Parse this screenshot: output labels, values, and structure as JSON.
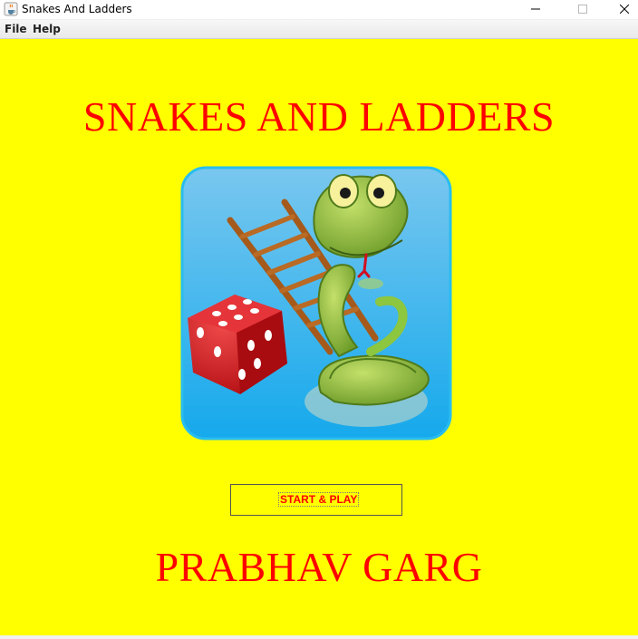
{
  "window": {
    "title": "Snakes And Ladders",
    "icon": "java-coffee-icon",
    "controls": [
      "minimize-icon",
      "maximize-icon",
      "close-icon"
    ]
  },
  "menubar": {
    "items": [
      {
        "label": "File"
      },
      {
        "label": "Help"
      }
    ]
  },
  "main": {
    "title": "SNAKES AND LADDERS",
    "start_button": "START & PLAY",
    "author": "PRABHAV GARG",
    "logo_icon": "snakes-and-ladders-logo"
  },
  "colors": {
    "background": "#ffff00",
    "title_text": "#ff0000",
    "logo_frame": "#3cc6f5",
    "dice": "#d81e1e",
    "ladder": "#b5651d",
    "snake": "#8dc63f"
  }
}
